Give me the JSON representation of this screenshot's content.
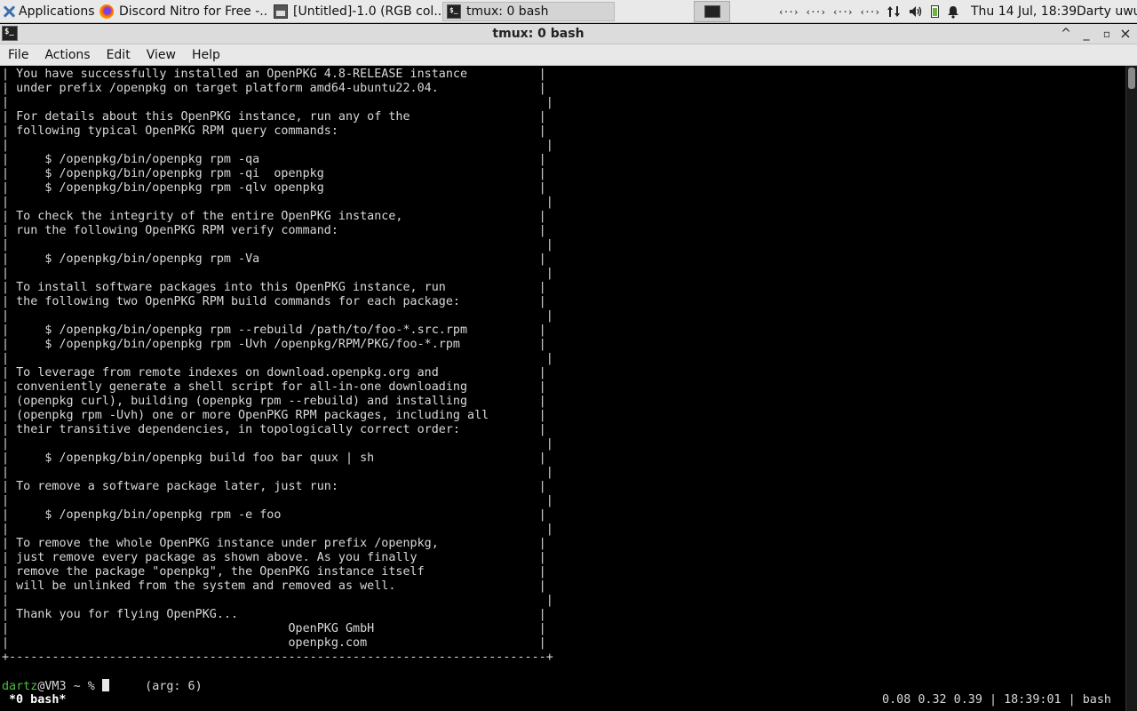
{
  "panel": {
    "applications_label": "Applications",
    "tasks": [
      {
        "label": "Discord Nitro for Free -...",
        "icon": "firefox-icon"
      },
      {
        "label": "[Untitled]-1.0 (RGB col...",
        "icon": "image-editor-icon"
      },
      {
        "label": "tmux: 0 bash",
        "icon": "terminal-icon"
      }
    ],
    "tray": {
      "network_indicators": [
        "‹··›",
        "‹··›",
        "‹··›",
        "‹··›"
      ],
      "icons": [
        "network-transfer-icon",
        "volume-icon",
        "battery-icon",
        "notification-bell-icon"
      ]
    },
    "clock": "Thu 14 Jul, 18:39",
    "user": "Darty uwu"
  },
  "window": {
    "title": "tmux: 0 bash",
    "buttons": {
      "maximize": "^",
      "minimize": "_",
      "restore": "▫",
      "close": "×"
    }
  },
  "menubar": {
    "items": [
      "File",
      "Actions",
      "Edit",
      "View",
      "Help"
    ]
  },
  "terminal": {
    "lines": [
      "| You have successfully installed an OpenPKG 4.8-RELEASE instance          |",
      "| under prefix /openpkg on target platform amd64-ubuntu22.04.              |",
      "|                                                                           |",
      "| For details about this OpenPKG instance, run any of the                  |",
      "| following typical OpenPKG RPM query commands:                            |",
      "|                                                                           |",
      "|     $ /openpkg/bin/openpkg rpm -qa                                       |",
      "|     $ /openpkg/bin/openpkg rpm -qi  openpkg                              |",
      "|     $ /openpkg/bin/openpkg rpm -qlv openpkg                              |",
      "|                                                                           |",
      "| To check the integrity of the entire OpenPKG instance,                   |",
      "| run the following OpenPKG RPM verify command:                            |",
      "|                                                                           |",
      "|     $ /openpkg/bin/openpkg rpm -Va                                       |",
      "|                                                                           |",
      "| To install software packages into this OpenPKG instance, run             |",
      "| the following two OpenPKG RPM build commands for each package:           |",
      "|                                                                           |",
      "|     $ /openpkg/bin/openpkg rpm --rebuild /path/to/foo-*.src.rpm          |",
      "|     $ /openpkg/bin/openpkg rpm -Uvh /openpkg/RPM/PKG/foo-*.rpm           |",
      "|                                                                           |",
      "| To leverage from remote indexes on download.openpkg.org and              |",
      "| conveniently generate a shell script for all-in-one downloading          |",
      "| (openpkg curl), building (openpkg rpm --rebuild) and installing          |",
      "| (openpkg rpm -Uvh) one or more OpenPKG RPM packages, including all       |",
      "| their transitive dependencies, in topologically correct order:           |",
      "|                                                                           |",
      "|     $ /openpkg/bin/openpkg build foo bar quux | sh                       |",
      "|                                                                           |",
      "| To remove a software package later, just run:                            |",
      "|                                                                           |",
      "|     $ /openpkg/bin/openpkg rpm -e foo                                    |",
      "|                                                                           |",
      "| To remove the whole OpenPKG instance under prefix /openpkg,              |",
      "| just remove every package as shown above. As you finally                 |",
      "| remove the package \"openpkg\", the OpenPKG instance itself                |",
      "| will be unlinked from the system and removed as well.                    |",
      "|                                                                           |",
      "| Thank you for flying OpenPKG...                                          |",
      "|                                       OpenPKG GmbH                       |",
      "|                                       openpkg.com                        |",
      "+---------------------------------------------------------------------------+"
    ],
    "prompt_user": "dartz",
    "prompt_rest": "@VM3 ~ % ",
    "prompt_after_cursor": "     (arg: 6)"
  },
  "tmux_status": {
    "window_label": "*0 bash*",
    "right": "0.08 0.32 0.39 | 18:39:01 | bash"
  }
}
